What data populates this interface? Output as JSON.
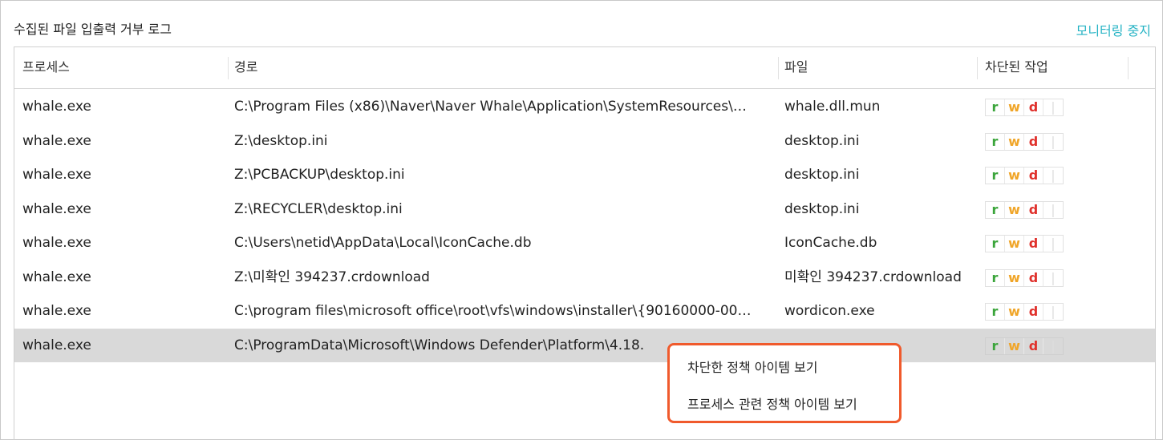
{
  "panel": {
    "title": "수집된 파일 입출력 거부 로그",
    "stop_monitoring": "모니터링 중지"
  },
  "table": {
    "headers": {
      "process": "프로세스",
      "path": "경로",
      "file": "파일",
      "blocked_ops": "차단된 작업"
    },
    "rows": [
      {
        "process": "whale.exe",
        "path": "C:\\Program Files (x86)\\Naver\\Naver Whale\\Application\\SystemResources\\…",
        "file": "whale.dll.mun",
        "ops": [
          "r",
          "w",
          "d",
          "|"
        ]
      },
      {
        "process": "whale.exe",
        "path": "Z:\\desktop.ini",
        "file": "desktop.ini",
        "ops": [
          "r",
          "w",
          "d",
          "|"
        ]
      },
      {
        "process": "whale.exe",
        "path": "Z:\\PCBACKUP\\desktop.ini",
        "file": "desktop.ini",
        "ops": [
          "r",
          "w",
          "d",
          "|"
        ]
      },
      {
        "process": "whale.exe",
        "path": "Z:\\RECYCLER\\desktop.ini",
        "file": "desktop.ini",
        "ops": [
          "r",
          "w",
          "d",
          "|"
        ]
      },
      {
        "process": "whale.exe",
        "path": "C:\\Users\\netid\\AppData\\Local\\IconCache.db",
        "file": "IconCache.db",
        "ops": [
          "r",
          "w",
          "d",
          "|"
        ]
      },
      {
        "process": "whale.exe",
        "path": "Z:\\미확인 394237.crdownload",
        "file": "미확인 394237.crdownload",
        "ops": [
          "r",
          "w",
          "d",
          "|"
        ]
      },
      {
        "process": "whale.exe",
        "path": "C:\\program files\\microsoft office\\root\\vfs\\windows\\installer\\{90160000-00…",
        "file": "wordicon.exe",
        "ops": [
          "r",
          "w",
          "d",
          "|"
        ]
      },
      {
        "process": "whale.exe",
        "path": "C:\\ProgramData\\Microsoft\\Windows Defender\\Platform\\4.18.",
        "file": "",
        "ops": [
          "r",
          "w",
          "d",
          "|"
        ],
        "selected": true
      }
    ]
  },
  "context_menu": {
    "items": [
      "차단한 정책 아이템 보기",
      "프로세스 관련 정책 아이템 보기"
    ],
    "border_color": "#f05a2c"
  },
  "colors": {
    "accent": "#24b3c4",
    "read": "#3ba53b",
    "write": "#f0a528",
    "delete": "#e0312c",
    "selected_row": "#d9d9d9"
  }
}
